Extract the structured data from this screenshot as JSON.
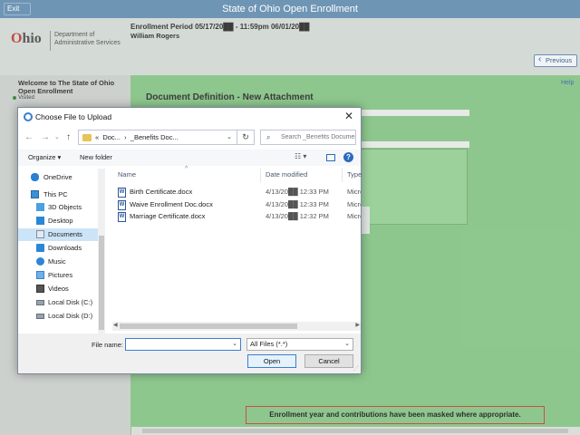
{
  "topbar": {
    "exit_label": "Exit",
    "title": "State of Ohio Open Enrollment"
  },
  "header": {
    "logo_text_accent": "O",
    "logo_text_rest": "hio",
    "department": "Department of Administrative Services",
    "enrollment_period": "Enrollment Period 05/17/20██ - 11:59pm 06/01/20██",
    "user_name": "William Rogers",
    "previous_label": "Previous"
  },
  "sidebar": {
    "welcome": "Welcome to The State of Ohio Open Enrollment",
    "visited": "Visited"
  },
  "main": {
    "help_label": "Help",
    "doc_title": "Document Definition - New Attachment",
    "notice": "Enrollment year and contributions have been masked where appropriate."
  },
  "dialog": {
    "title": "Choose File to Upload",
    "address": [
      "«",
      "Doc...",
      "›",
      "_Benefits Doc..."
    ],
    "search_placeholder": "Search _Benefits Documenta...",
    "organize_label": "Organize ▾",
    "new_folder_label": "New folder",
    "nav_items": [
      {
        "label": "OneDrive",
        "icon": "cloud-icon",
        "top": true
      },
      {
        "label": "This PC",
        "icon": "computer-icon",
        "top": true
      },
      {
        "label": "3D Objects",
        "icon": "cube-icon"
      },
      {
        "label": "Desktop",
        "icon": "desktop-icon"
      },
      {
        "label": "Documents",
        "icon": "documents-icon",
        "selected": true
      },
      {
        "label": "Downloads",
        "icon": "download-icon"
      },
      {
        "label": "Music",
        "icon": "music-icon"
      },
      {
        "label": "Pictures",
        "icon": "pictures-icon"
      },
      {
        "label": "Videos",
        "icon": "videos-icon"
      },
      {
        "label": "Local Disk (C:)",
        "icon": "drive-icon"
      },
      {
        "label": "Local Disk (D:)",
        "icon": "drive-icon"
      }
    ],
    "columns": {
      "name": "Name",
      "date": "Date modified",
      "type": "Type"
    },
    "files": [
      {
        "name": "Birth Certificate.docx",
        "date": "4/13/20██ 12:33 PM",
        "type": "Micro"
      },
      {
        "name": "Waive Enrollment Doc.docx",
        "date": "4/13/20██ 12:33 PM",
        "type": "Micro"
      },
      {
        "name": "Marriage Certificate.docx",
        "date": "4/13/20██ 12:32 PM",
        "type": "Micro"
      }
    ],
    "file_name_label": "File name:",
    "file_name_value": "",
    "file_type_value": "All Files (*.*)",
    "open_label": "Open",
    "cancel_label": "Cancel"
  }
}
